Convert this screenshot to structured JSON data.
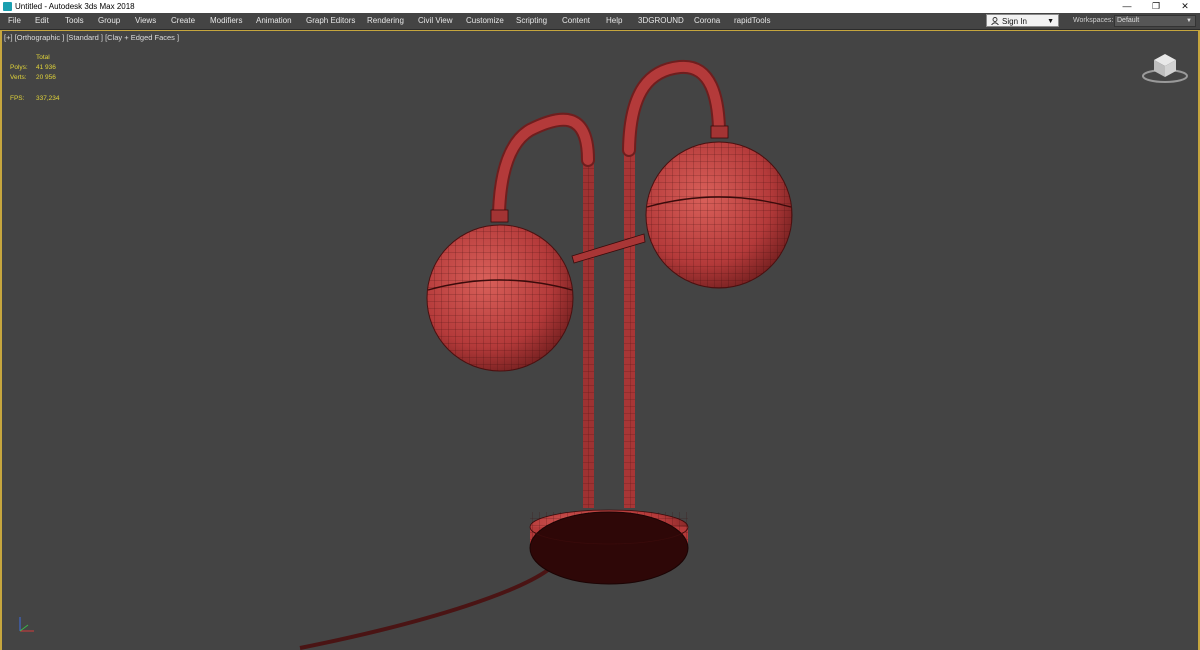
{
  "window": {
    "title": "Untitled - Autodesk 3ds Max 2018",
    "controls": [
      "—",
      "❐",
      "✕"
    ]
  },
  "menu": {
    "items": [
      "File",
      "Edit",
      "Tools",
      "Group",
      "Views",
      "Create",
      "Modifiers",
      "Animation",
      "Graph Editors",
      "Rendering",
      "Civil View",
      "Customize",
      "Scripting",
      "Content",
      "Help",
      "3DGROUND",
      "Corona",
      "rapidTools"
    ],
    "sign_in": "Sign In",
    "workspaces_label": "Workspaces:",
    "workspaces_value": "Default"
  },
  "viewport": {
    "label": "[+] [Orthographic ] [Standard ] [Clay + Edged Faces ]",
    "stats": {
      "header": "Total",
      "polys_label": "Polys:",
      "polys_value": "41 936",
      "verts_label": "Verts:",
      "verts_value": "20 956",
      "fps_label": "FPS:",
      "fps_value": "337,234"
    },
    "model_color": "#b43a3a",
    "wire_color": "#3a0b0b",
    "border_color": "#c6a63e"
  },
  "icons": {
    "app": "3ds-max-icon",
    "user": "user-icon",
    "viewcube": "viewcube-icon",
    "axis": "axis-gizmo-icon"
  }
}
